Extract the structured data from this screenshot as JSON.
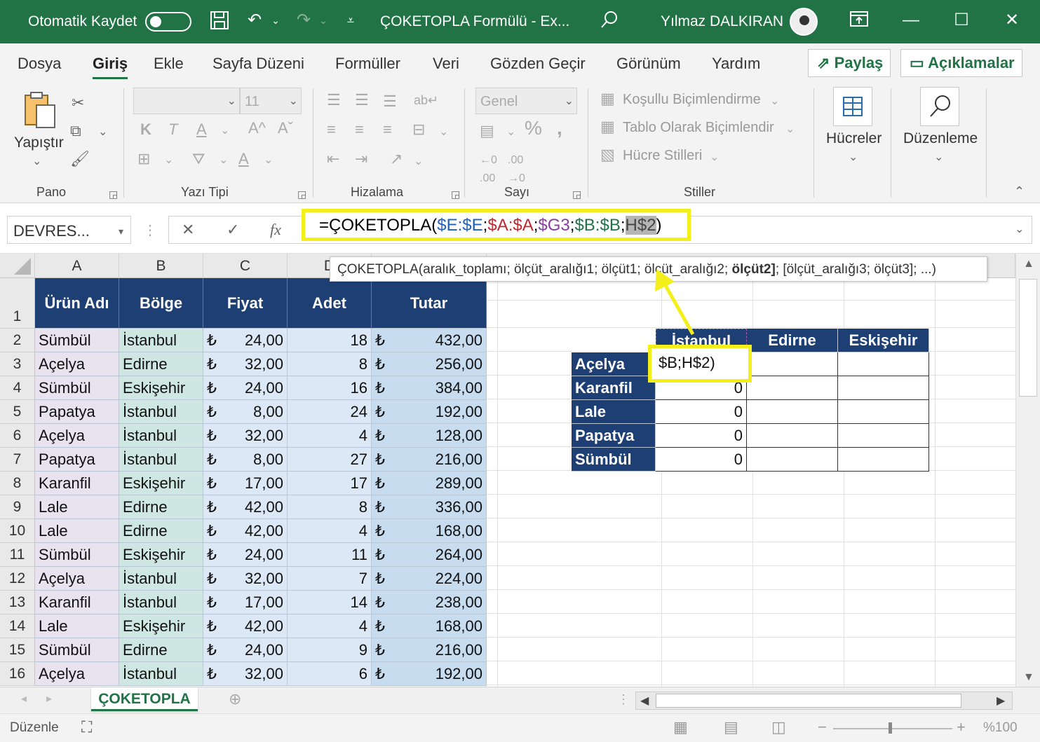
{
  "titlebar": {
    "autosave_label": "Otomatik Kaydet",
    "doc_title": "ÇOKETOPLA Formülü  -  Ex...",
    "user_name": "Yılmaz DALKIRAN"
  },
  "tabs": [
    "Dosya",
    "Giriş",
    "Ekle",
    "Sayfa Düzeni",
    "Formüller",
    "Veri",
    "Gözden Geçir",
    "Görünüm",
    "Yardım"
  ],
  "share_label": "Paylaş",
  "comments_label": "Açıklamalar",
  "ribbon": {
    "paste_label": "Yapıştır",
    "pano_label": "Pano",
    "font_size": "11",
    "yazi_tipi_label": "Yazı Tipi",
    "hizalama_label": "Hizalama",
    "number_format": "Genel",
    "sayi_label": "Sayı",
    "cond_format": "Koşullu Biçimlendirme",
    "table_format": "Tablo Olarak Biçimlendir",
    "cell_styles": "Hücre Stilleri",
    "stiller_label": "Stiller",
    "cells_label": "Hücreler",
    "editing_label": "Düzenleme"
  },
  "formula_bar": {
    "name_box": "DEVRES...",
    "formula_prefix": "=ÇOKETOPLA(",
    "arg1": "$E:$E",
    "arg2": "$A:$A",
    "arg3": "$G3",
    "arg4": "$B:$B",
    "arg5": "H$2",
    "sep": ";",
    "close": ")"
  },
  "tooltip": {
    "pre": "ÇOKETOPLA(aralık_toplamı; ölçüt_aralığı1; ölçüt1; ölçüt_aralığı2; ",
    "bold": "ölçüt2]",
    "post": "; [ölçüt_aralığı3; ölçüt3]; ...)"
  },
  "columns": [
    "A",
    "B",
    "C",
    "D",
    "E"
  ],
  "table": {
    "headers": [
      "Ürün Adı",
      "Bölge",
      "Fiyat",
      "Adet",
      "Tutar"
    ],
    "currency": "₺",
    "rows": [
      {
        "product": "Sümbül",
        "region": "İstanbul",
        "price": "24,00",
        "qty": "18",
        "total": "432,00"
      },
      {
        "product": "Açelya",
        "region": "Edirne",
        "price": "32,00",
        "qty": "8",
        "total": "256,00"
      },
      {
        "product": "Sümbül",
        "region": "Eskişehir",
        "price": "24,00",
        "qty": "16",
        "total": "384,00"
      },
      {
        "product": "Papatya",
        "region": "İstanbul",
        "price": "8,00",
        "qty": "24",
        "total": "192,00"
      },
      {
        "product": "Açelya",
        "region": "İstanbul",
        "price": "32,00",
        "qty": "4",
        "total": "128,00"
      },
      {
        "product": "Papatya",
        "region": "İstanbul",
        "price": "8,00",
        "qty": "27",
        "total": "216,00"
      },
      {
        "product": "Karanfil",
        "region": "Eskişehir",
        "price": "17,00",
        "qty": "17",
        "total": "289,00"
      },
      {
        "product": "Lale",
        "region": "Edirne",
        "price": "42,00",
        "qty": "8",
        "total": "336,00"
      },
      {
        "product": "Lale",
        "region": "Edirne",
        "price": "42,00",
        "qty": "4",
        "total": "168,00"
      },
      {
        "product": "Sümbül",
        "region": "Eskişehir",
        "price": "24,00",
        "qty": "11",
        "total": "264,00"
      },
      {
        "product": "Açelya",
        "region": "İstanbul",
        "price": "32,00",
        "qty": "7",
        "total": "224,00"
      },
      {
        "product": "Karanfil",
        "region": "İstanbul",
        "price": "17,00",
        "qty": "14",
        "total": "238,00"
      },
      {
        "product": "Lale",
        "region": "Eskişehir",
        "price": "42,00",
        "qty": "4",
        "total": "168,00"
      },
      {
        "product": "Sümbül",
        "region": "Edirne",
        "price": "24,00",
        "qty": "9",
        "total": "216,00"
      },
      {
        "product": "Açelya",
        "region": "İstanbul",
        "price": "32,00",
        "qty": "6",
        "total": "192,00"
      }
    ]
  },
  "summary": {
    "headers": [
      "İstanbul",
      "Edirne",
      "Eskişehir"
    ],
    "rows": [
      {
        "label": "Açelya",
        "istanbul": "$B;H$2)"
      },
      {
        "label": "Karanfil",
        "istanbul": "0"
      },
      {
        "label": "Lale",
        "istanbul": "0"
      },
      {
        "label": "Papatya",
        "istanbul": "0"
      },
      {
        "label": "Sümbül",
        "istanbul": "0"
      }
    ]
  },
  "sheet_tab": "ÇOKETOPLA",
  "status": {
    "mode": "Düzenle",
    "zoom": "%100"
  },
  "colors": {
    "excel_green": "#217346",
    "header_navy": "#1e3f74",
    "highlight_yellow": "#f2ef1a"
  }
}
